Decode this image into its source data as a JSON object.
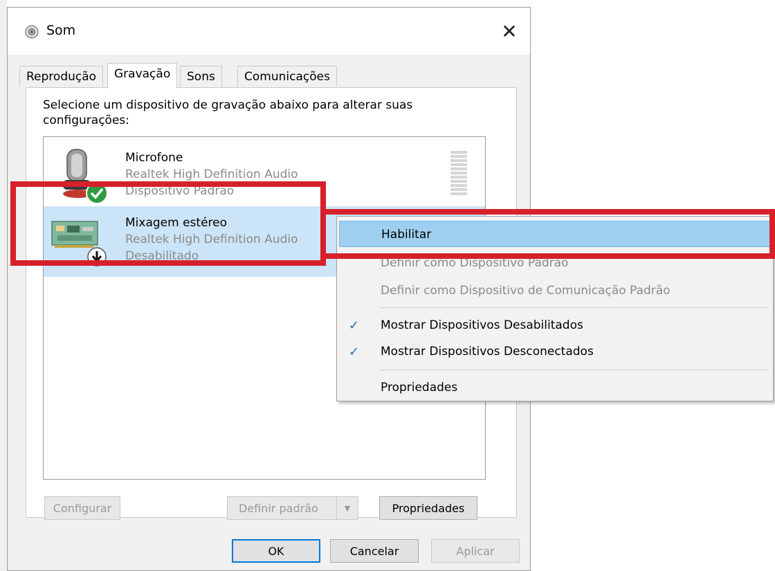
{
  "window": {
    "title": "Som",
    "close_glyph": "✕"
  },
  "tabs": [
    {
      "label": "Reprodução"
    },
    {
      "label": "Gravação"
    },
    {
      "label": "Sons"
    },
    {
      "label": "Comunicações"
    }
  ],
  "instructions": "Selecione um dispositivo de gravação abaixo para alterar suas configurações:",
  "devices": [
    {
      "name": "Microfone",
      "driver": "Realtek High Definition Audio",
      "status": "Dispositivo Padrão",
      "icon": "microphone-icon",
      "badge": "default-check-icon"
    },
    {
      "name": "Mixagem estéreo",
      "driver": "Realtek High Definition Audio",
      "status": "Desabilitado",
      "icon": "sound-card-icon",
      "badge": "disabled-arrow-icon"
    }
  ],
  "buttons": {
    "configure": "Configurar",
    "set_default": "Definir padrão",
    "properties": "Propriedades",
    "ok": "OK",
    "cancel": "Cancelar",
    "apply": "Aplicar"
  },
  "context_menu": {
    "items": [
      {
        "label": "Habilitar",
        "highlighted": true
      },
      {
        "label": "Definir como Dispositivo Padrão",
        "disabled": true
      },
      {
        "label": "Definir como Dispositivo de Comunicação Padrão",
        "disabled": true
      },
      {
        "label": "Mostrar Dispositivos Desabilitados",
        "checked": true
      },
      {
        "label": "Mostrar Dispositivos Desconectados",
        "checked": true
      },
      {
        "label": "Propriedades"
      }
    ],
    "check_glyph": "✓"
  },
  "colors": {
    "highlight": "#9fcff0",
    "annotation_red": "#d6202a",
    "selection": "#cce4f7",
    "accent": "#0078d7"
  }
}
